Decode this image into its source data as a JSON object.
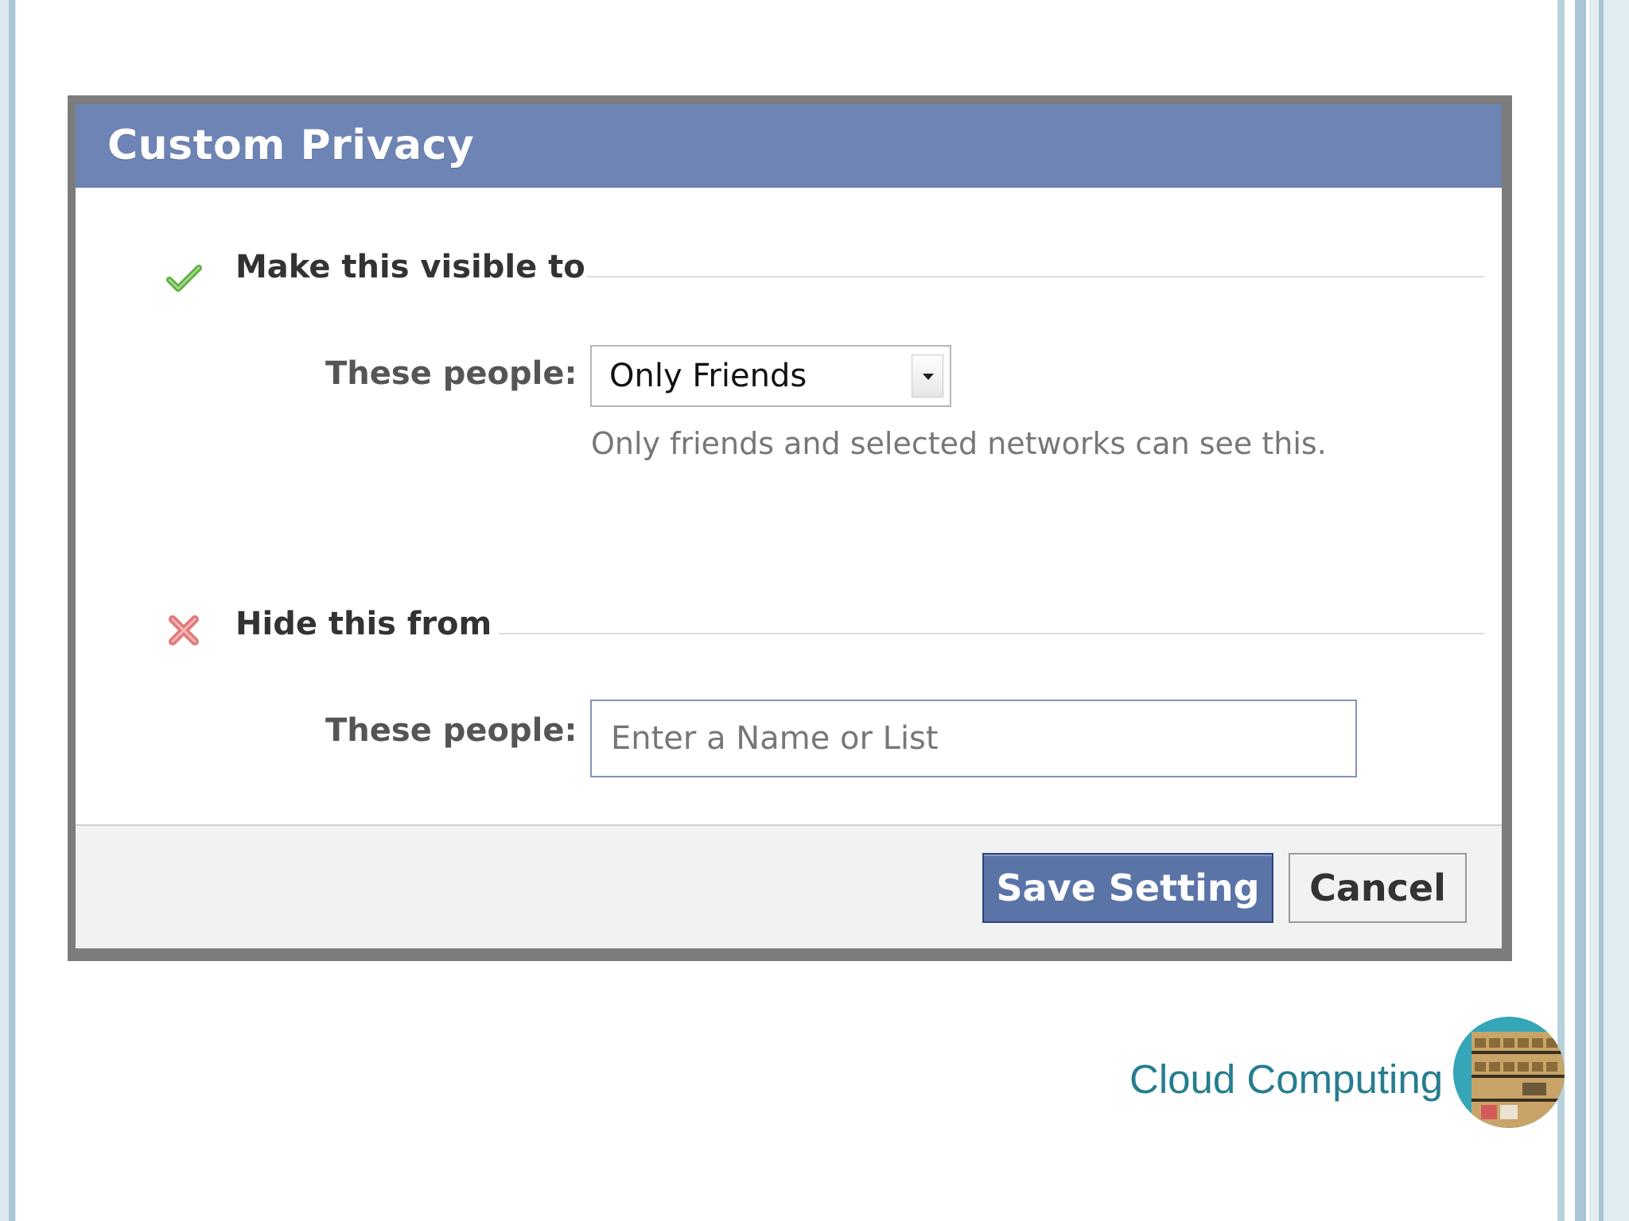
{
  "dialog": {
    "title": "Custom Privacy",
    "visible_section": {
      "title": "Make this visible to",
      "icon": "check-icon",
      "icon_color": "#5eae3c",
      "people_label": "These people:",
      "selected_option": "Only Friends",
      "help_text": "Only friends and selected networks can see this."
    },
    "hide_section": {
      "title": "Hide this from",
      "icon": "x-icon",
      "icon_color": "#e07a7a",
      "people_label": "These people:",
      "input_placeholder": "Enter a Name or List",
      "input_value": ""
    },
    "footer": {
      "save_label": "Save Setting",
      "cancel_label": "Cancel"
    }
  },
  "slide": {
    "footer_text": "Cloud Computing",
    "logo": "cloud-computing-logo"
  },
  "colors": {
    "header": "#6d84b4",
    "save_button": "#5b74a8",
    "footer_text": "#267d8f"
  }
}
